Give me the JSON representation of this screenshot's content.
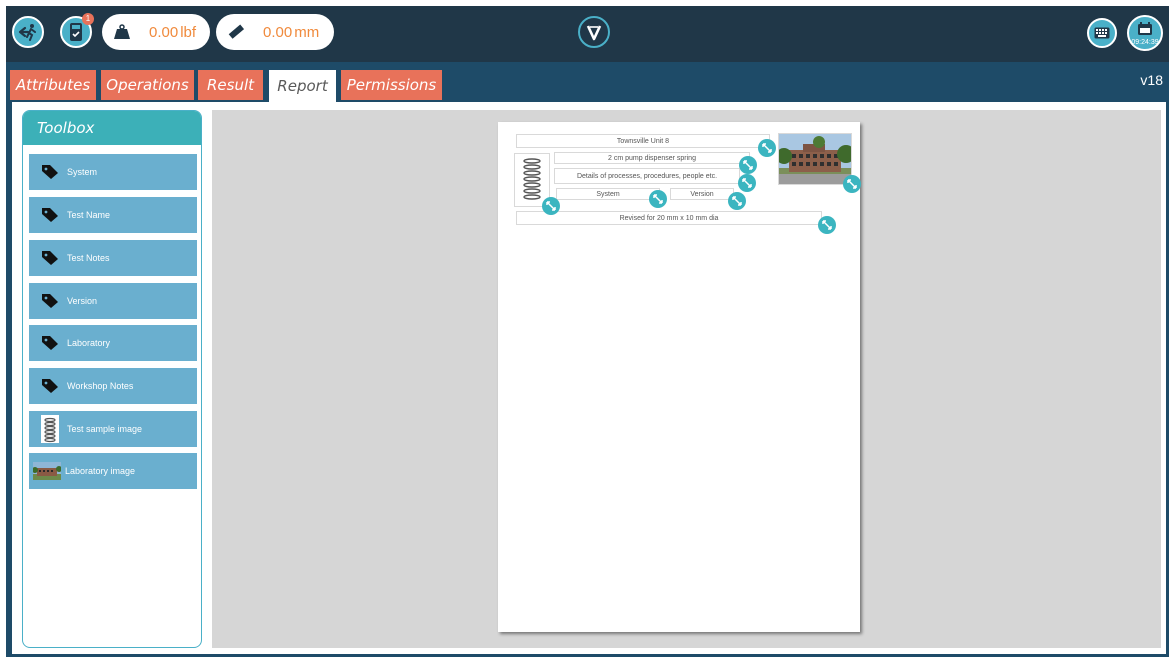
{
  "topbar": {
    "exit_icon": "exit-running-icon",
    "tasks_badge": "1",
    "force": {
      "value": "0.00",
      "unit": "lbf"
    },
    "distance": {
      "value": "0.00",
      "unit": "mm"
    },
    "clock_time": "09:24:39"
  },
  "tabs": [
    {
      "label": "Attributes",
      "active": false
    },
    {
      "label": "Operations",
      "active": false
    },
    {
      "label": "Result",
      "active": false
    },
    {
      "label": "Report",
      "active": true
    },
    {
      "label": "Permissions",
      "active": false
    }
  ],
  "version": "v18",
  "toolbox": {
    "title": "Toolbox",
    "items": [
      {
        "label": "System",
        "icon": "tag-icon"
      },
      {
        "label": "Test Name",
        "icon": "tag-icon"
      },
      {
        "label": "Test Notes",
        "icon": "tag-icon"
      },
      {
        "label": "Version",
        "icon": "tag-icon"
      },
      {
        "label": "Laboratory",
        "icon": "tag-icon"
      },
      {
        "label": "Workshop Notes",
        "icon": "tag-icon"
      },
      {
        "label": "Test sample image",
        "icon": "spring-image-icon"
      },
      {
        "label": "Laboratory image",
        "icon": "building-image-icon"
      }
    ]
  },
  "report": {
    "laboratory": "Townsville Unit 8",
    "test_name": "2 cm pump dispenser spring",
    "test_notes": "Details of  processes, procedures, people etc.",
    "system": "System",
    "version": "Version",
    "workshop_notes": "Revised for 20 mm x 10 mm dia"
  },
  "colors": {
    "topbar": "#203748",
    "frame": "#1e4b68",
    "accent": "#4ab0c8",
    "tab": "#e8725a",
    "toolbox_item": "#6aafcf",
    "value_text": "#f08a3c"
  }
}
